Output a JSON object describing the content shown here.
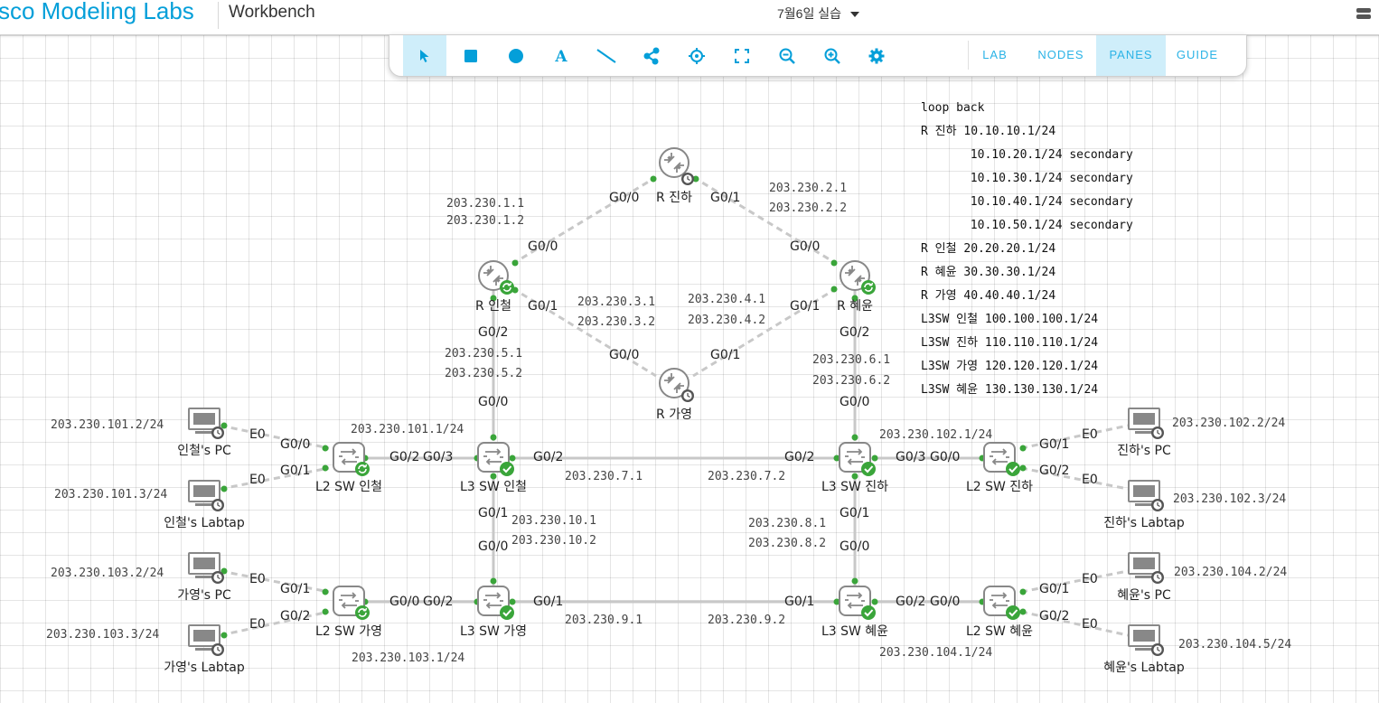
{
  "header": {
    "brand": "sco Modeling Labs",
    "section": "Workbench",
    "lab_name": "7월6일 실습"
  },
  "toolbar": {
    "tools": [
      "pointer-icon",
      "square-icon",
      "circle-icon",
      "text-icon",
      "line-icon",
      "share-node-icon",
      "crosshair-icon",
      "fit-screen-icon",
      "zoom-out-icon",
      "zoom-in-icon",
      "settings-icon"
    ],
    "tabs": [
      "LAB",
      "NODES",
      "PANES",
      "GUIDE"
    ],
    "active_tab": "PANES",
    "accent_color": "#2bb3e6"
  },
  "annotation": [
    "loop back",
    "R 진하 10.10.10.1/24",
    "       10.10.20.1/24 secondary",
    "       10.10.30.1/24 secondary",
    "       10.10.40.1/24 secondary",
    "       10.10.50.1/24 secondary",
    "R 인철 20.20.20.1/24",
    "R 혜윤 30.30.30.1/24",
    "R 가영 40.40.40.1/24",
    "L3SW 인철 100.100.100.1/24",
    "L3SW 진하 110.110.110.1/24",
    "L3SW 가영 120.120.120.1/24",
    "L3SW 혜윤 130.130.130.1/24"
  ],
  "nodes": {
    "r_jinha": "R 진하",
    "r_incheol": "R 인철",
    "r_hyeyun": "R 혜윤",
    "r_gayoung": "R 가영",
    "l3_incheol": "L3 SW 인철",
    "l3_jinha": "L3 SW 진하",
    "l3_gayoung": "L3 SW 가영",
    "l3_hyeyun": "L3 SW 혜윤",
    "l2_incheol": "L2 SW 인철",
    "l2_jinha": "L2 SW 진하",
    "l2_gayoung": "L2 SW 가영",
    "l2_hyeyun": "L2 SW 혜윤",
    "pc_incheol": "인철's PC",
    "lt_incheol": "인철's Labtap",
    "pc_gayoung": "가영's PC",
    "lt_gayoung": "가영's Labtap",
    "pc_jinha": "진하's PC",
    "lt_jinha": "진하's Labtap",
    "pc_hyeyun": "혜윤's PC",
    "lt_hyeyun": "혜윤's Labtap"
  },
  "ifaces": {
    "g00": "G0/0",
    "g01": "G0/1",
    "g02": "G0/2",
    "g03": "G0/3",
    "e0": "E0"
  },
  "ips": {
    "a1_1": "203.230.1.1",
    "a1_2": "203.230.1.2",
    "a2_1": "203.230.2.1",
    "a2_2": "203.230.2.2",
    "a3_1": "203.230.3.1",
    "a3_2": "203.230.3.2",
    "a4_1": "203.230.4.1",
    "a4_2": "203.230.4.2",
    "a5_1": "203.230.5.1",
    "a5_2": "203.230.5.2",
    "a6_1": "203.230.6.1",
    "a6_2": "203.230.6.2",
    "a7_1": "203.230.7.1",
    "a7_2": "203.230.7.2",
    "a8_1": "203.230.8.1",
    "a8_2": "203.230.8.2",
    "a9_1": "203.230.9.1",
    "a9_2": "203.230.9.2",
    "a10_1": "203.230.10.1",
    "a10_2": "203.230.10.2",
    "h101_1": "203.230.101.1/24",
    "h101_2": "203.230.101.2/24",
    "h101_3": "203.230.101.3/24",
    "h102_1": "203.230.102.1/24",
    "h102_2": "203.230.102.2/24",
    "h102_3": "203.230.102.3/24",
    "h103_1": "203.230.103.1/24",
    "h103_2": "203.230.103.2/24",
    "h103_3": "203.230.103.3/24",
    "h104_1": "203.230.104.1/24",
    "h104_2": "203.230.104.2/24",
    "h104_5": "203.230.104.5/24"
  }
}
